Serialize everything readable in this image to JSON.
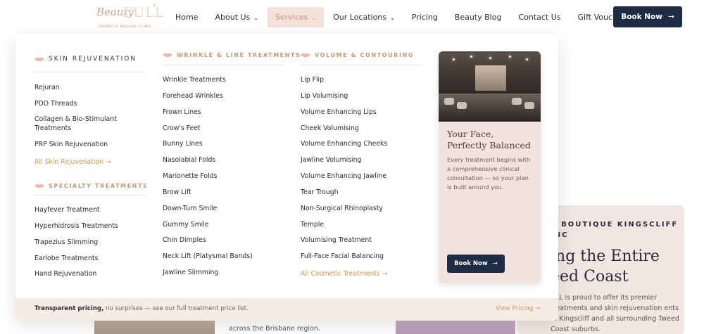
{
  "logo": {
    "script": "Beauty",
    "word": "FULL",
    "tagline": "COSMETIC MEDICAL CLINIC"
  },
  "nav": {
    "items": [
      {
        "label": "Home",
        "chev": ""
      },
      {
        "label": "About Us",
        "chev": "⌄"
      },
      {
        "label": "Services",
        "chev": "⌄"
      },
      {
        "label": "Our Locations",
        "chev": "⌄"
      },
      {
        "label": "Pricing",
        "chev": ""
      },
      {
        "label": "Beauty Blog",
        "chev": ""
      },
      {
        "label": "Contact Us",
        "chev": ""
      },
      {
        "label": "Gift Vouchers",
        "chev": ""
      }
    ],
    "active_index": 2,
    "book_label": "Book Now",
    "arrow": "→"
  },
  "background": {
    "brisbane_text": "across the Brisbane region.",
    "card_kicker_1": "R BOUTIQUE KINGSCLIFF",
    "card_kicker_2": "NIC",
    "card_heading_1": "ing the Entire",
    "card_heading_2": "eed Coast",
    "card_text": "ULL is proud to offer its premier treatments and skin rejuvenation ents of Kingscliff and all surrounding Tweed Coast suburbs."
  },
  "menu": {
    "skin": {
      "heading": "Skin Rejuvenation",
      "items": [
        "Rejuran",
        "PDO Threads",
        "Collagen & Bio-Stimulant Treatments",
        "PRP Skin Rejuvenation"
      ],
      "all_link": "All Skin Rejuvenation →"
    },
    "specialty": {
      "heading": "Specialty Treatments",
      "items": [
        "Hayfever Treatment",
        "Hyperhidrosis Treatments",
        "Trapezius Slimming",
        "Earlobe Treatments",
        "Hand Rejuvenation"
      ]
    },
    "wrinkle": {
      "heading": "Wrinkle & Line Treatments",
      "items": [
        "Wrinkle Treatments",
        "Forehead Wrinkles",
        "Frown Lines",
        "Crow's Feet",
        "Bunny Lines",
        "Nasolabial Folds",
        "Marionette Folds",
        "Brow Lift",
        "Down-Turn Smile",
        "Gummy Smile",
        "Chin Dimples",
        "Neck Lift (Platysmal Bands)",
        "Jawline Slimming"
      ]
    },
    "volume": {
      "heading": "Volume & Contouring",
      "items": [
        "Lip Flip",
        "Lip Volumising",
        "Volume Enhancing Lips",
        "Cheek Volumising",
        "Volume Enhancing Cheeks",
        "Jawline Volumising",
        "Volume Enhancing Jawline",
        "Tear Trough",
        "Non-Surgical Rhinoplasty",
        "Temple",
        "Volumising Treatment",
        "Full-Face Facial Balancing"
      ],
      "all_link": "All Cosmetic Treatments →"
    },
    "promo": {
      "title": "Your Face, Perfectly Balanced",
      "text": "Every treatment begins with a comprehensive clinical consultation — so your plan is built around you.",
      "button": "Book Now",
      "arrow": "→"
    },
    "footer": {
      "bold": "Transparent pricing,",
      "rest": " no surprises — see our full treatment price list.",
      "link": "View Pricing →"
    }
  },
  "colors": {
    "navy": "#1e2b45",
    "accent": "#c8966f",
    "gold_link": "#d19a55",
    "blush": "#f4e1da"
  }
}
